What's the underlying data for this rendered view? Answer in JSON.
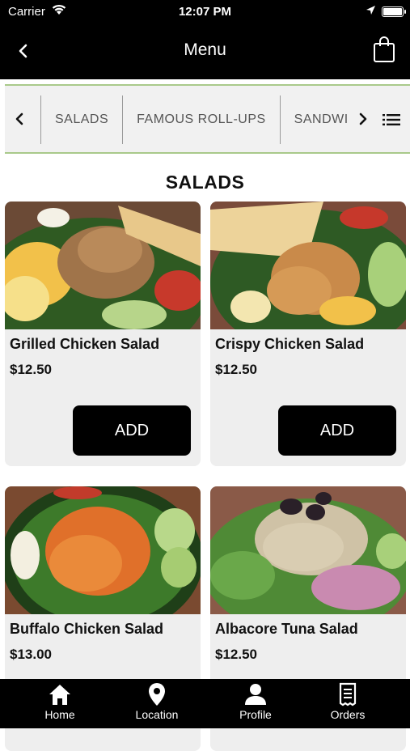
{
  "status_bar": {
    "carrier": "Carrier",
    "time": "12:07 PM"
  },
  "nav": {
    "title": "Menu"
  },
  "categories": [
    "SALADS",
    "FAMOUS ROLL-UPS",
    "SANDWI"
  ],
  "section_title": "SALADS",
  "items": [
    {
      "name": "Grilled Chicken Salad",
      "price": "$12.50",
      "add_label": "ADD"
    },
    {
      "name": "Crispy Chicken Salad",
      "price": "$12.50",
      "add_label": "ADD"
    },
    {
      "name": "Buffalo Chicken Salad",
      "price": "$13.00"
    },
    {
      "name": "Albacore Tuna Salad",
      "price": "$12.50"
    }
  ],
  "tabs": [
    {
      "label": "Home",
      "icon": "home-icon"
    },
    {
      "label": "Location",
      "icon": "location-pin-icon"
    },
    {
      "label": "Profile",
      "icon": "person-icon"
    },
    {
      "label": "Orders",
      "icon": "receipt-icon"
    }
  ],
  "colors": {
    "bar_bg": "#000000",
    "accent_line": "#a9c98a",
    "card_bg": "#eeeeee"
  }
}
